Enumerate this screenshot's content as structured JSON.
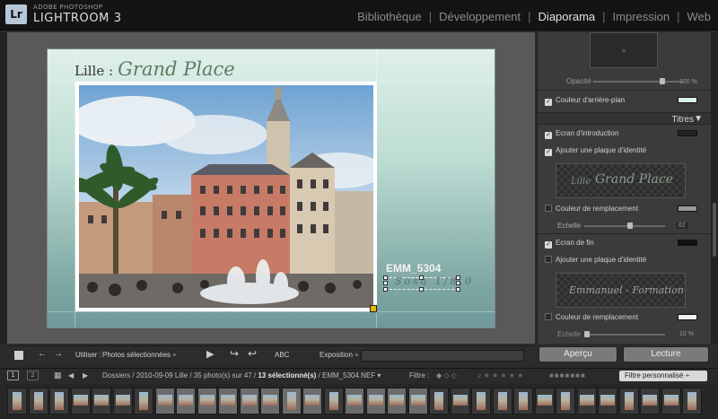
{
  "app": {
    "brand_small": "ADOBE PHOTOSHOP",
    "brand_big": "LIGHTROOM 3",
    "logo": "Lr"
  },
  "modules": [
    {
      "label": "Bibliothèque",
      "active": false
    },
    {
      "label": "Développement",
      "active": false
    },
    {
      "label": "Diaporama",
      "active": true
    },
    {
      "label": "Impression",
      "active": false
    },
    {
      "label": "Web",
      "active": false
    }
  ],
  "slide": {
    "title_prefix": "Lille :",
    "title_name": "Grand Place",
    "caption": "EMM_5304",
    "identity_overlay": "Sosa 1/8,0"
  },
  "right_panel": {
    "opacity_label": "Opacité",
    "opacity_value": "100 %",
    "bg_color_label": "Couleur d'arrière-plan",
    "section_title": "Titres",
    "intro_screen_label": "Ecran d'introduction",
    "add_identity_label": "Ajouter une plaque d'identité",
    "intro_plate_text_1": "Lille",
    "intro_plate_text_2": "Grand Place",
    "replacement_color_label": "Couleur de remplacement",
    "scale_label": "Echelle",
    "scale_value": "62",
    "end_screen_label": "Ecran de fin",
    "add_identity_label_2": "Ajouter une plaque d'identité",
    "end_plate_text": "Emmanuel - Formation",
    "replacement_color_label_2": "Couleur de remplacement",
    "scale_label_2": "Echelle",
    "scale_value_2": "10 %",
    "preview_button": "Aperçu",
    "play_button": "Lecture",
    "swatch_colors": {
      "bg_color": "#d9efe6",
      "intro_color": "#222222",
      "replacement_1": "#9a9a9a",
      "end_color": "#111111",
      "replacement_2": "#f2f2f2"
    }
  },
  "toolbar": {
    "use_label": "Utiliser :",
    "use_value": "Photos sélectionnées",
    "abc_label": "ABC",
    "exposure_label": "Exposition"
  },
  "filmbar": {
    "monitor_1": "1",
    "monitor_2": "2",
    "path_text": "Dossiers / 2010-09-09 Lille / 35 photo(s) sur 47 / ",
    "selected_text": "13 sélectionné(s)",
    "file_text": " / EMM_5304.NEF",
    "filter_label": "Filtre :",
    "filter_select": "Filtre personnalisé"
  },
  "filmstrip": {
    "thumbs": [
      {
        "sel": false,
        "tall": true
      },
      {
        "sel": false,
        "tall": true
      },
      {
        "sel": false,
        "tall": true
      },
      {
        "sel": false,
        "tall": false
      },
      {
        "sel": false,
        "tall": false
      },
      {
        "sel": false,
        "tall": false
      },
      {
        "sel": false,
        "tall": true
      },
      {
        "sel": true,
        "tall": false
      },
      {
        "sel": true,
        "tall": false
      },
      {
        "sel": true,
        "tall": false
      },
      {
        "sel": true,
        "tall": false
      },
      {
        "sel": true,
        "tall": false
      },
      {
        "sel": true,
        "tall": false
      },
      {
        "sel": true,
        "tall": true
      },
      {
        "sel": true,
        "tall": false
      },
      {
        "sel": false,
        "tall": true
      },
      {
        "sel": true,
        "tall": false
      },
      {
        "sel": true,
        "tall": false
      },
      {
        "sel": true,
        "tall": false
      },
      {
        "sel": true,
        "tall": false
      },
      {
        "sel": false,
        "tall": true
      },
      {
        "sel": false,
        "tall": false
      },
      {
        "sel": false,
        "tall": true
      },
      {
        "sel": false,
        "tall": true
      },
      {
        "sel": false,
        "tall": true
      },
      {
        "sel": false,
        "tall": false
      },
      {
        "sel": false,
        "tall": true
      },
      {
        "sel": false,
        "tall": false
      },
      {
        "sel": false,
        "tall": false
      },
      {
        "sel": false,
        "tall": true
      },
      {
        "sel": false,
        "tall": false
      },
      {
        "sel": false,
        "tall": false
      },
      {
        "sel": false,
        "tall": true
      }
    ]
  }
}
